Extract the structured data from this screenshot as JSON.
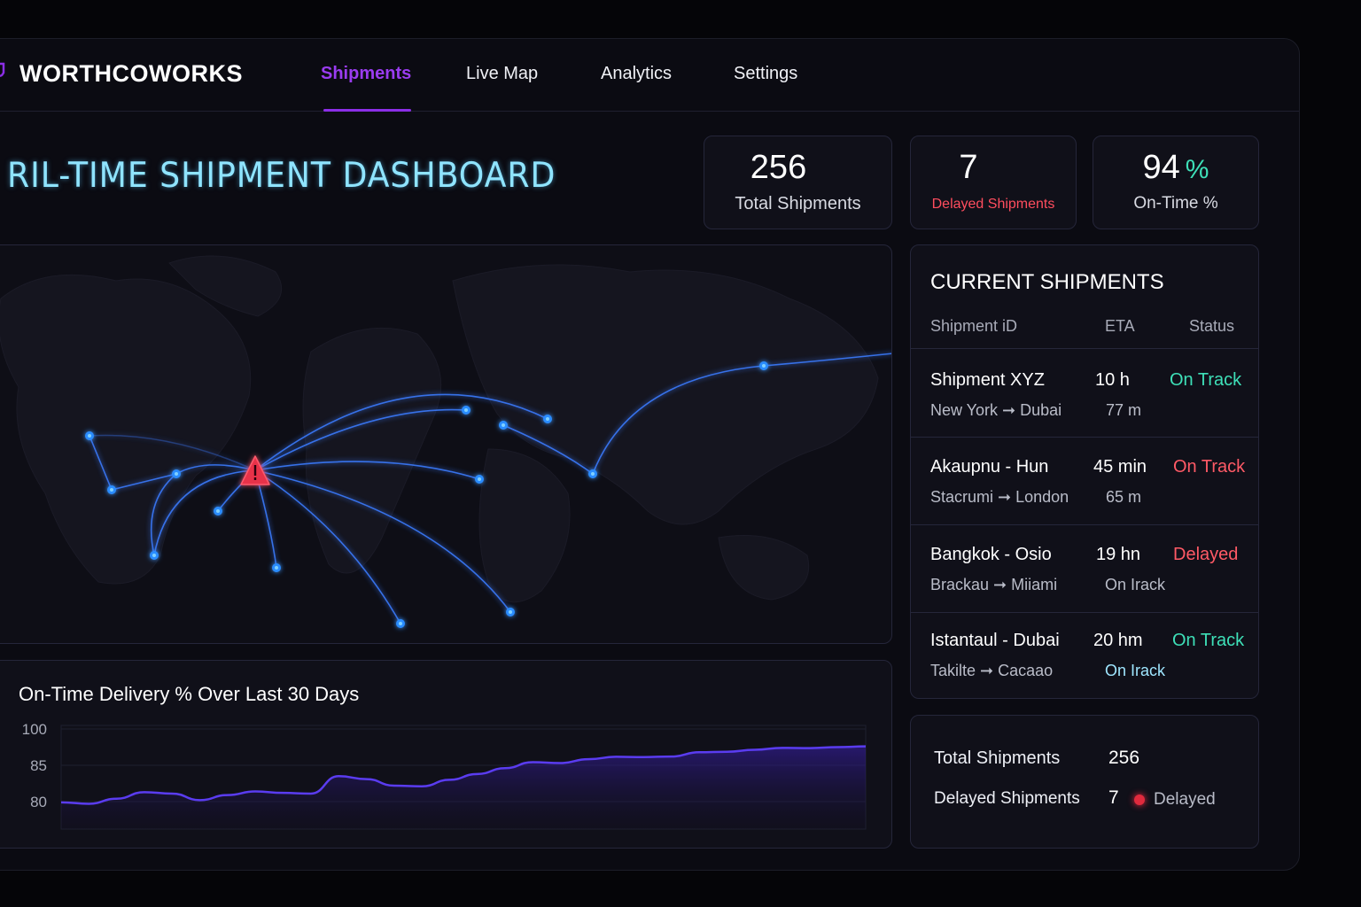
{
  "brand": {
    "name": "WORTHCOWORKS",
    "accent": "#8b2ee6"
  },
  "nav": [
    {
      "label": "Shipments",
      "active": true
    },
    {
      "label": "Live Map",
      "active": false
    },
    {
      "label": "Analytics",
      "active": false
    },
    {
      "label": "Settings",
      "active": false
    }
  ],
  "page": {
    "title": "RIL-TIME SHIPMENT DASHBOARD"
  },
  "stats": {
    "total": {
      "value": "256",
      "label": "Total Shipments"
    },
    "delayed": {
      "value": "7",
      "label": "Delayed Shipments",
      "color": "#ff4d5e"
    },
    "ontime": {
      "value": "94",
      "unit": "%",
      "label": "On-Time %",
      "unit_color": "#3ee0b8"
    }
  },
  "map": {
    "alert_icon": "warning-triangle-icon",
    "route_color": "#3b7bff",
    "alert_color": "#e8334a"
  },
  "shipments": {
    "title": "CURRENT SHIPMENTS",
    "columns": [
      "Shipment iD",
      "ETA",
      "Status"
    ],
    "rows": [
      {
        "name": "Shipment XYZ",
        "route_from": "New York",
        "route_to": "Dubai",
        "eta": "10 h",
        "distance": "77 m",
        "status": "On Track",
        "status_color": "#3ee0b8"
      },
      {
        "name": "Akaupnu - Hun",
        "route_from": "Stacrumi",
        "route_to": "London",
        "eta": "45 min",
        "distance": "65 m",
        "status": "On Track",
        "status_color": "#ff5a66"
      },
      {
        "name": "Bangkok - Osio",
        "route_from": "Brackau",
        "route_to": "Miiami",
        "eta": "19 hn",
        "distance": "On Irack",
        "status": "Delayed",
        "status_color": "#ff5a66"
      },
      {
        "name": "Istantaul - Dubai",
        "route_from": "Takilte",
        "route_to": "Cacaao",
        "eta": "20 hm",
        "distance": "On Irack",
        "status": "On Track",
        "status_color": "#3ee0b8"
      }
    ]
  },
  "summary": {
    "total_label": "Total Shipments",
    "total_value": "256",
    "delayed_label": "Delayed Shipments",
    "delayed_value": "7",
    "delayed_badge": "Delayed"
  },
  "chart_data": {
    "type": "area",
    "title": "On-Time Delivery % Over Last 30 Days",
    "yticks": [
      "100",
      "85",
      "80"
    ],
    "x": [
      1,
      2,
      3,
      4,
      5,
      6,
      7,
      8,
      9,
      10,
      11,
      12,
      13,
      14,
      15,
      16,
      17,
      18,
      19,
      20,
      21,
      22,
      23,
      24,
      25,
      26,
      27,
      28,
      29,
      30
    ],
    "values": [
      79.9,
      79.7,
      80.4,
      81.3,
      81.1,
      80.2,
      80.9,
      81.4,
      81.2,
      81.1,
      83.5,
      83.1,
      82.2,
      82.1,
      83.0,
      83.8,
      84.6,
      86.3,
      85.9,
      87.5,
      88.5,
      88.4,
      88.6,
      90.4,
      90.6,
      91.4,
      92.2,
      92.1,
      92.5,
      92.8
    ],
    "line_color": "#5a3cf0"
  }
}
